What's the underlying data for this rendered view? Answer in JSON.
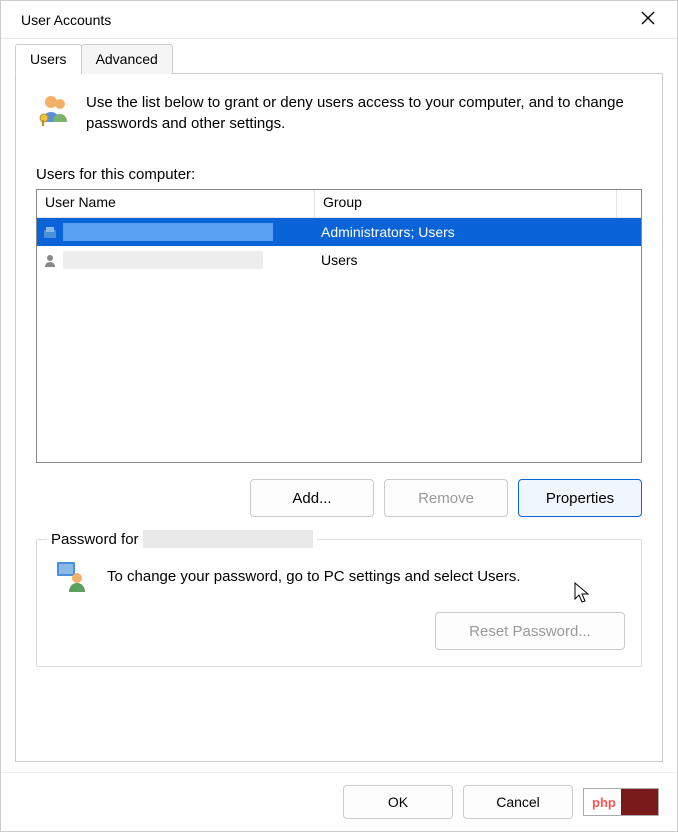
{
  "window": {
    "title": "User Accounts",
    "close_icon": "✕"
  },
  "tabs": {
    "users": "Users",
    "advanced": "Advanced",
    "active": "users"
  },
  "intro": {
    "text": "Use the list below to grant or deny users access to your computer, and to change passwords and other settings."
  },
  "list": {
    "label": "Users for this computer:",
    "columns": {
      "username": "User Name",
      "group": "Group"
    },
    "rows": [
      {
        "username": "",
        "group": "Administrators; Users",
        "selected": true
      },
      {
        "username": "",
        "group": "Users",
        "selected": false
      }
    ]
  },
  "buttons": {
    "add": "Add...",
    "remove": "Remove",
    "properties": "Properties"
  },
  "password_section": {
    "legend_prefix": "Password for",
    "text": "To change your password, go to PC settings and select Users.",
    "reset": "Reset Password..."
  },
  "footer": {
    "ok": "OK",
    "cancel": "Cancel",
    "php_badge": "php"
  }
}
